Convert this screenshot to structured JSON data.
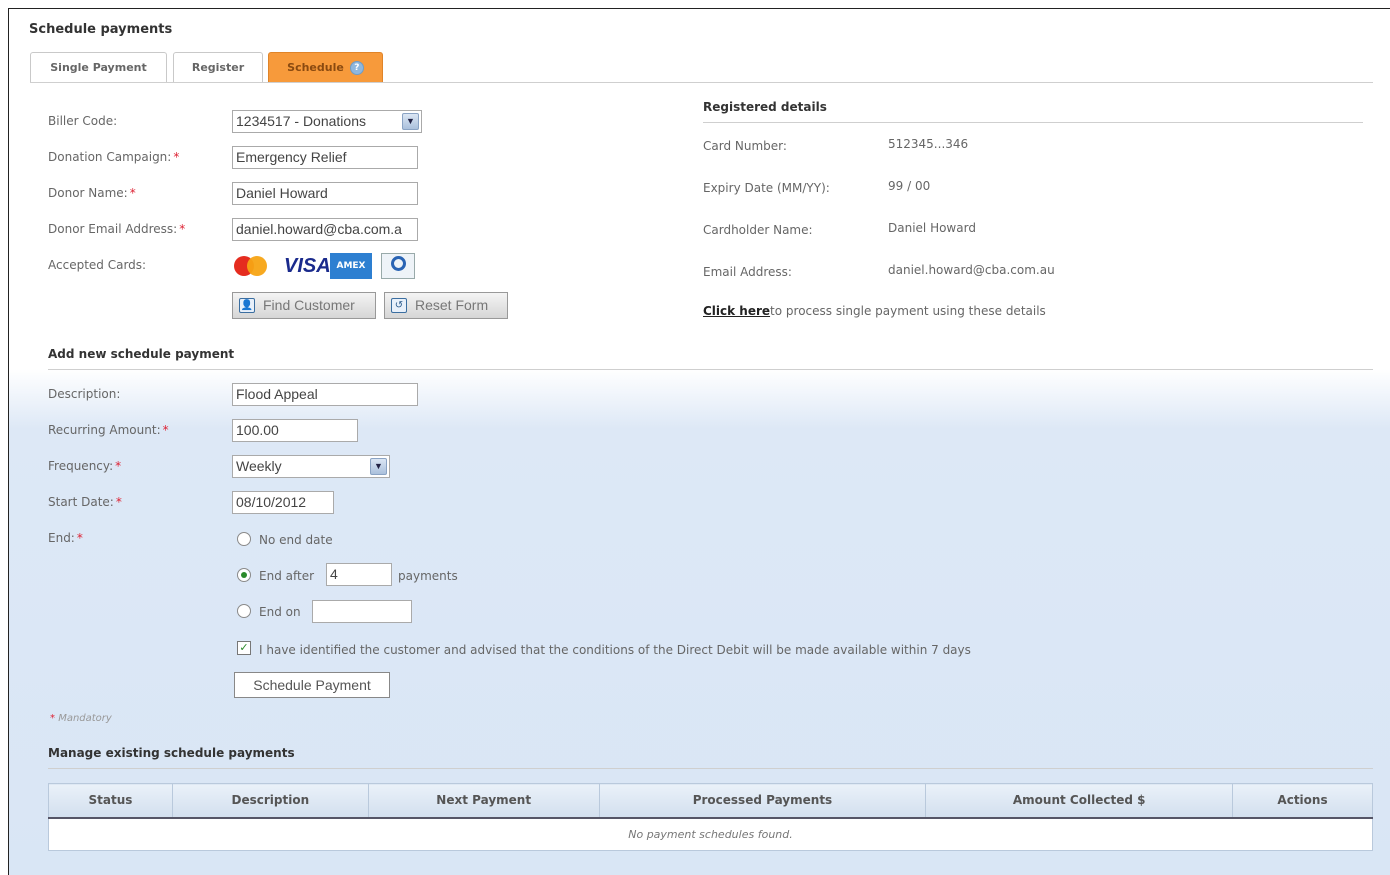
{
  "page_title": "Schedule payments",
  "tabs": [
    {
      "label": "Single Payment"
    },
    {
      "label": "Register"
    },
    {
      "label": "Schedule",
      "active": true
    }
  ],
  "form": {
    "biller_code": {
      "label": "Biller Code:",
      "value": "1234517 - Donations"
    },
    "donation_campaign": {
      "label": "Donation Campaign:",
      "value": "Emergency Relief"
    },
    "donor_name": {
      "label": "Donor Name:",
      "value": "Daniel Howard"
    },
    "donor_email": {
      "label": "Donor Email Address:",
      "value": "daniel.howard@cba.com.a"
    },
    "accepted_cards": {
      "label": "Accepted Cards:",
      "cards": [
        "mastercard",
        "VISA",
        "AMEX",
        "diners"
      ]
    },
    "find_customer_label": "Find Customer",
    "reset_form_label": "Reset Form",
    "required_mark": "*"
  },
  "registered": {
    "heading": "Registered details",
    "card_number": {
      "label": "Card Number:",
      "value": "512345...346"
    },
    "expiry": {
      "label": "Expiry Date (MM/YY):",
      "value": "99 / 00"
    },
    "cardholder": {
      "label": "Cardholder Name:",
      "value": "Daniel Howard"
    },
    "email": {
      "label": "Email Address:",
      "value": "daniel.howard@cba.com.au"
    },
    "link_text": "Click here",
    "link_suffix": "to process single payment using these details"
  },
  "schedule": {
    "heading": "Add new schedule payment",
    "description": {
      "label": "Description:",
      "value": "Flood Appeal"
    },
    "recurring_amount": {
      "label": "Recurring Amount:",
      "value": "100.00"
    },
    "frequency": {
      "label": "Frequency:",
      "value": "Weekly"
    },
    "start_date": {
      "label": "Start Date:",
      "value": "08/10/2012"
    },
    "end": {
      "label": "End:",
      "no_end_date": "No end date",
      "end_after": "End after",
      "end_after_value": "4",
      "payments_suffix": "payments",
      "end_on": "End on",
      "end_on_value": "",
      "selected": "end_after"
    },
    "consent_text": "I have identified the customer and advised that the conditions of the Direct Debit will be made available within 7 days",
    "consent_checked": true,
    "submit_label": "Schedule Payment",
    "mandatory_note": "Mandatory"
  },
  "manage": {
    "heading": "Manage existing schedule payments",
    "columns": [
      "Status",
      "Description",
      "Next Payment",
      "Processed Payments",
      "Amount Collected $",
      "Actions"
    ],
    "empty_text": "No payment schedules found."
  },
  "colors": {
    "active_tab": "#f79a3b",
    "required": "#dd2233"
  }
}
